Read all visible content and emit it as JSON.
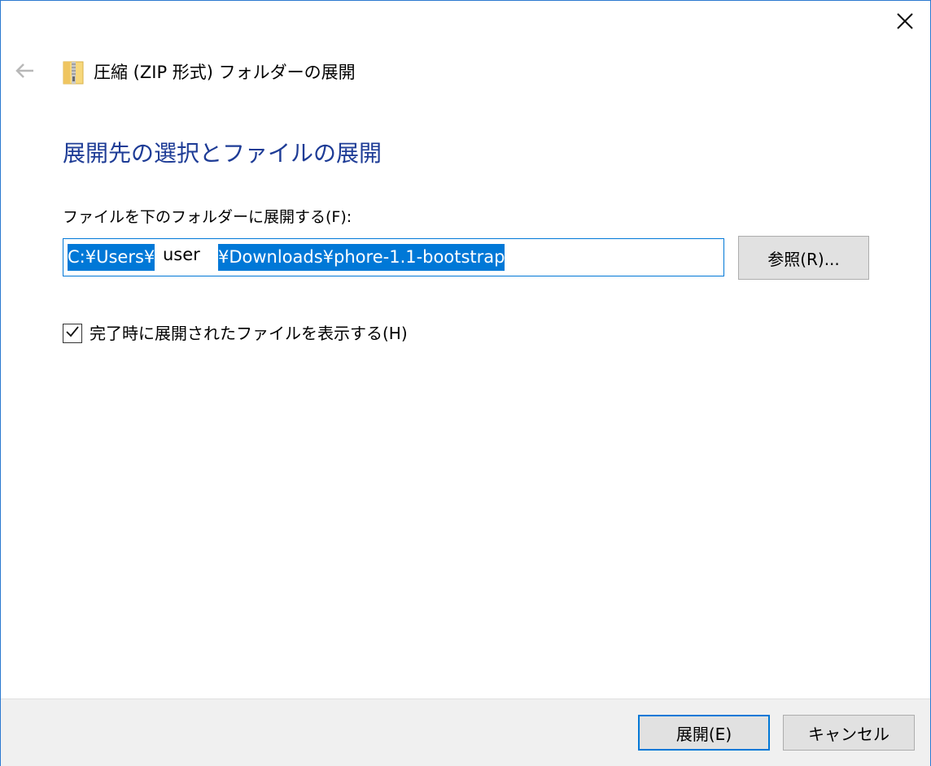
{
  "window": {
    "title": "圧縮 (ZIP 形式) フォルダーの展開",
    "accent_color": "#0078d7",
    "heading_color": "#1e3c96"
  },
  "icons": {
    "close": "close-icon",
    "back": "back-arrow-icon",
    "zip_folder": "zip-folder-icon",
    "check": "checkmark-icon"
  },
  "main": {
    "heading": "展開先の選択とファイルの展開",
    "field_label": "ファイルを下のフォルダーに展開する(F):",
    "path": {
      "prefix": "C:¥Users¥",
      "user": "user",
      "suffix": "¥Downloads¥phore-1.1-bootstrap"
    },
    "browse_label": "参照(R)...",
    "checkbox": {
      "label": "完了時に展開されたファイルを表示する(H)",
      "checked": true
    }
  },
  "footer": {
    "extract_label": "展開(E)",
    "cancel_label": "キャンセル"
  }
}
